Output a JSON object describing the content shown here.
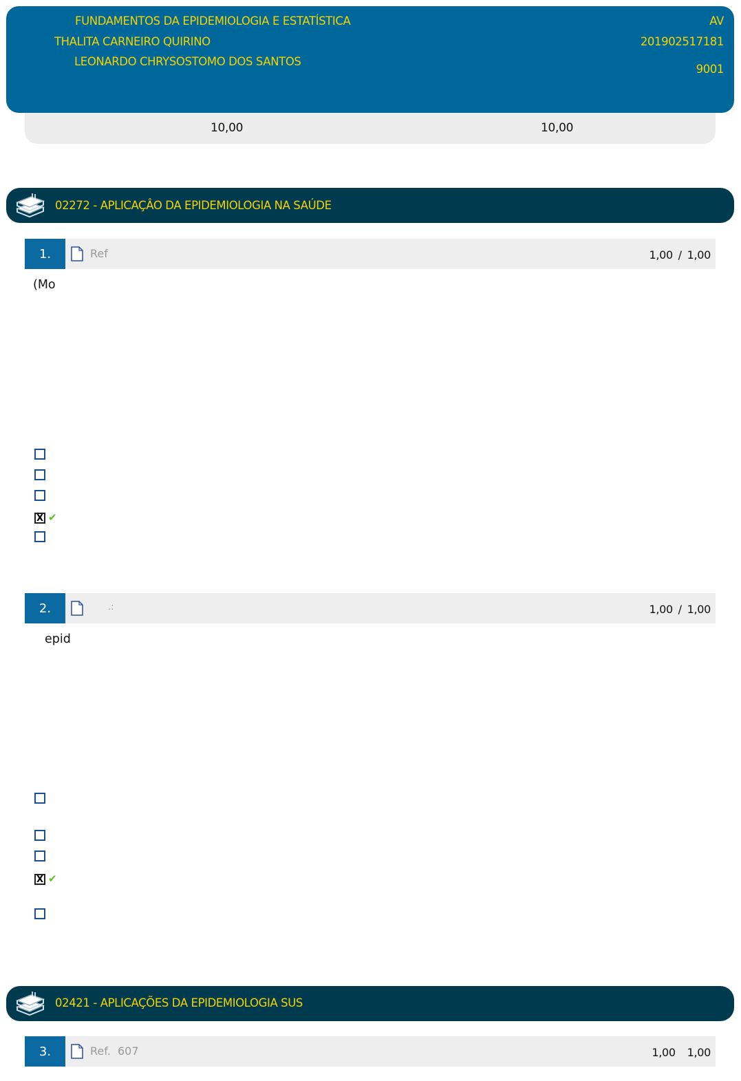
{
  "header": {
    "course": "FUNDAMENTOS DA EPIDEMIOLOGIA E ESTATÍSTICA",
    "student": "THALITA CARNEIRO QUIRINO",
    "teacher": "LEONARDO CHRYSOSTOMO DOS SANTOS",
    "type": "AV",
    "matricula": "201902517181",
    "turma": "9001",
    "score_left": "10,00",
    "score_right": "10,00"
  },
  "sections": [
    {
      "title": "02272 - APLICAÇÂO DA EPIDEMIOLOGIA NA SAÚDE"
    },
    {
      "title": "02421 - APLICAÇÕES DA EPIDEMIOLOGIA SUS"
    }
  ],
  "questions": [
    {
      "number": "1.",
      "ref": "Ref",
      "score": "1,00",
      "sep": "/",
      "max": "1,00",
      "text": "(Mo"
    },
    {
      "number": "2.",
      "ref": ".:",
      "score": "1,00",
      "sep": "/",
      "max": "1,00",
      "text": "epid"
    },
    {
      "number": "3.",
      "ref": "Ref.  607",
      "score": "1,00",
      "sep": "",
      "max": "1,00"
    }
  ],
  "options": {
    "checked_mark": "X",
    "correct_mark": "✔"
  },
  "colors": {
    "header_bg": "#00679a",
    "section_bg": "#003a4f",
    "accent_yellow": "#f5d400",
    "qnum_bg": "#0a6aa1",
    "correct_green": "#5cc318"
  }
}
